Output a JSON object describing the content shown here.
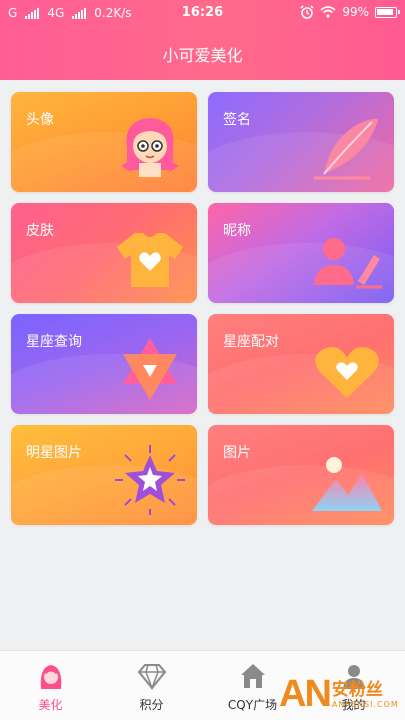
{
  "status": {
    "carrier_left": "G",
    "carrier_4g": "4G",
    "speed": "0.2K/s",
    "time": "16:26",
    "battery": "99%"
  },
  "header": {
    "title": "小可爱美化"
  },
  "cards": [
    {
      "label": "头像",
      "icon": "avatar-girl-icon"
    },
    {
      "label": "签名",
      "icon": "feather-pen-icon"
    },
    {
      "label": "皮肤",
      "icon": "tshirt-heart-icon"
    },
    {
      "label": "昵称",
      "icon": "person-edit-icon"
    },
    {
      "label": "星座查询",
      "icon": "star-of-david-icon"
    },
    {
      "label": "星座配对",
      "icon": "heart-icon"
    },
    {
      "label": "明星图片",
      "icon": "sparkling-star-icon"
    },
    {
      "label": "图片",
      "icon": "landscape-image-icon"
    }
  ],
  "tabs": [
    {
      "label": "美化",
      "icon": "beauty-face-icon",
      "active": true
    },
    {
      "label": "积分",
      "icon": "diamond-icon",
      "active": false
    },
    {
      "label": "CQY广场",
      "icon": "home-icon",
      "active": false
    },
    {
      "label": "我的",
      "icon": "user-icon",
      "active": false
    }
  ],
  "watermark": {
    "mark": "AN",
    "cn": "安粉丝",
    "en": "ANFENSI.COM"
  },
  "colors": {
    "accent": "#ff4f8b",
    "header": "#ff6090"
  }
}
